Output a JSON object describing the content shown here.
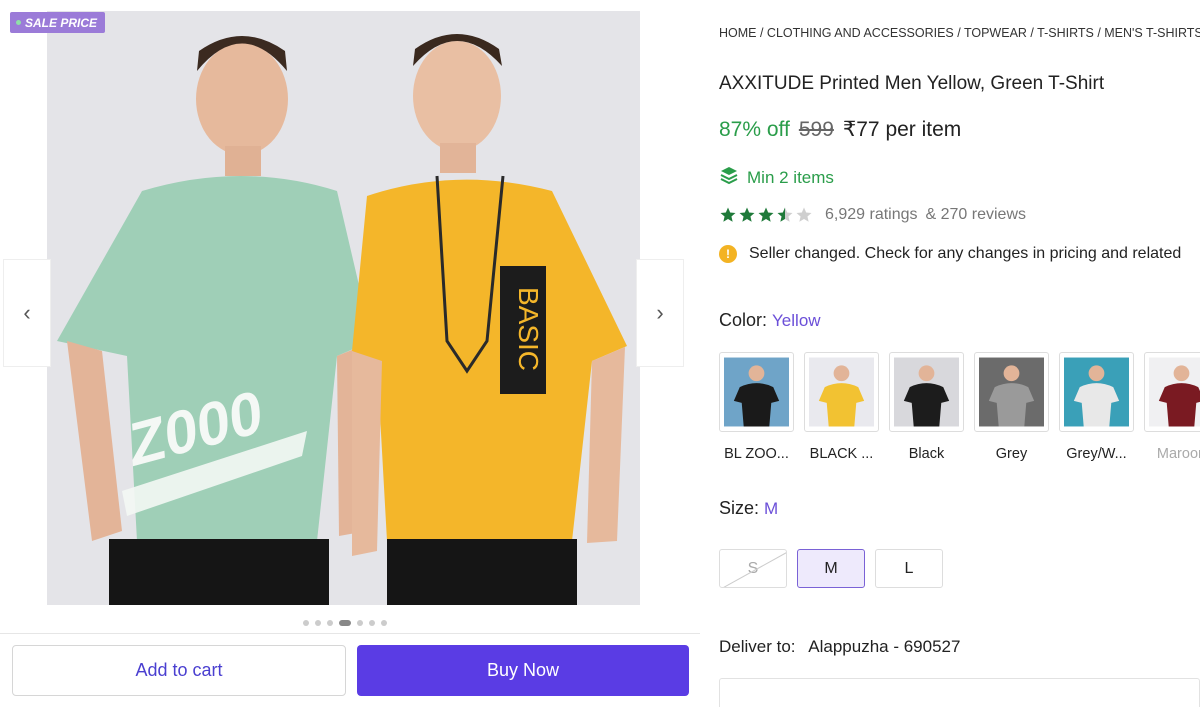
{
  "gallery": {
    "sale_badge": "SALE PRICE",
    "prev_icon": "chevron-left-icon",
    "next_icon": "chevron-right-icon",
    "image_count": 7,
    "active_index": 3,
    "green_shirt_print": "Z000",
    "yellow_shirt_print": "BASIC"
  },
  "actions": {
    "add_to_cart": "Add to cart",
    "buy_now": "Buy Now"
  },
  "product": {
    "breadcrumb": "HOME / CLOTHING AND ACCESSORIES / TOPWEAR / T-SHIRTS / MEN'S T-SHIRTS",
    "title": "AXXITUDE Printed Men Yellow, Green T-Shirt",
    "discount": "87% off",
    "mrp": "599",
    "price": "₹77 per item",
    "min_items": "Min 2 items",
    "rating_value": 3.5,
    "ratings": "6,929 ratings",
    "reviews": "& 270 reviews",
    "notice": "Seller changed. Check for any changes in pricing and related"
  },
  "color": {
    "label": "Color:",
    "selected": "Yellow",
    "options": [
      {
        "name": "BL ZOO...",
        "shirt": "#1a1a1a",
        "bg": "#6fa4c8"
      },
      {
        "name": "BLACK ...",
        "shirt": "#f2c232",
        "bg": "#e9e9ee"
      },
      {
        "name": "Black",
        "shirt": "#1c1c1c",
        "bg": "#d8d8dc"
      },
      {
        "name": "Grey",
        "shirt": "#9a9a9a",
        "bg": "#6b6b6b"
      },
      {
        "name": "Grey/W...",
        "shirt": "#e8e8e8",
        "bg": "#3aa0b8"
      },
      {
        "name": "Maroon",
        "shirt": "#7a1a22",
        "bg": "#f0f0f2"
      }
    ]
  },
  "size": {
    "label": "Size:",
    "selected": "M",
    "options": [
      {
        "label": "S",
        "state": "disabled"
      },
      {
        "label": "M",
        "state": "selected"
      },
      {
        "label": "L",
        "state": "available"
      }
    ]
  },
  "delivery": {
    "label": "Deliver to:",
    "location": "Alappuzha - 690527"
  }
}
